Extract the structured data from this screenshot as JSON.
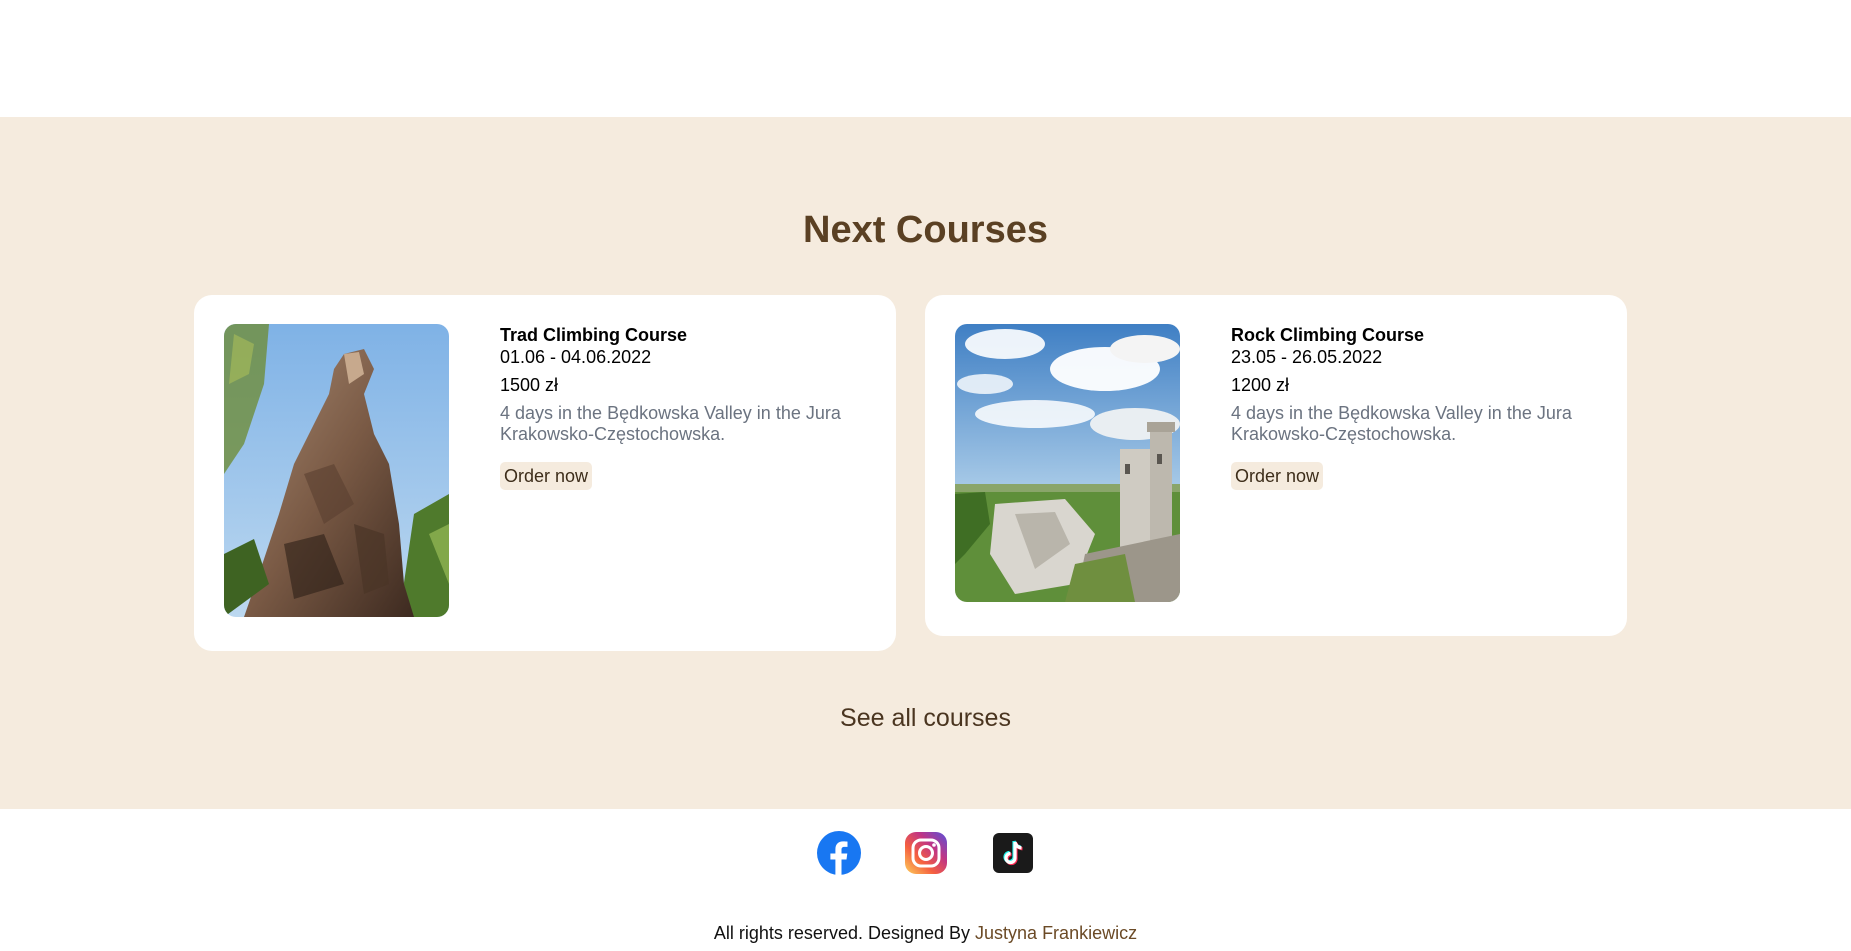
{
  "section": {
    "title": "Next Courses",
    "see_all_label": "See all courses"
  },
  "courses": [
    {
      "title": "Trad Climbing Course",
      "dates": "01.06 - 04.06.2022",
      "price": "1500 zł",
      "description": "4 days in the Będkowska Valley in the Jura Krakowsko-Częstochowska.",
      "order_label": "Order now"
    },
    {
      "title": "Rock Climbing Course",
      "dates": "23.05 - 26.05.2022",
      "price": "1200 zł",
      "description": "4 days in the Będkowska Valley in the Jura Krakowsko-Częstochowska.",
      "order_label": "Order now"
    }
  ],
  "footer": {
    "social": [
      "facebook-icon",
      "instagram-icon",
      "tiktok-icon"
    ],
    "copyright_prefix": "All rights reserved. Designed By ",
    "author": "Justyna Frankiewicz"
  },
  "colors": {
    "section_bg": "#f5ebde",
    "title": "#5a4023",
    "description": "#6b7380",
    "author_link": "#6b4a26"
  }
}
